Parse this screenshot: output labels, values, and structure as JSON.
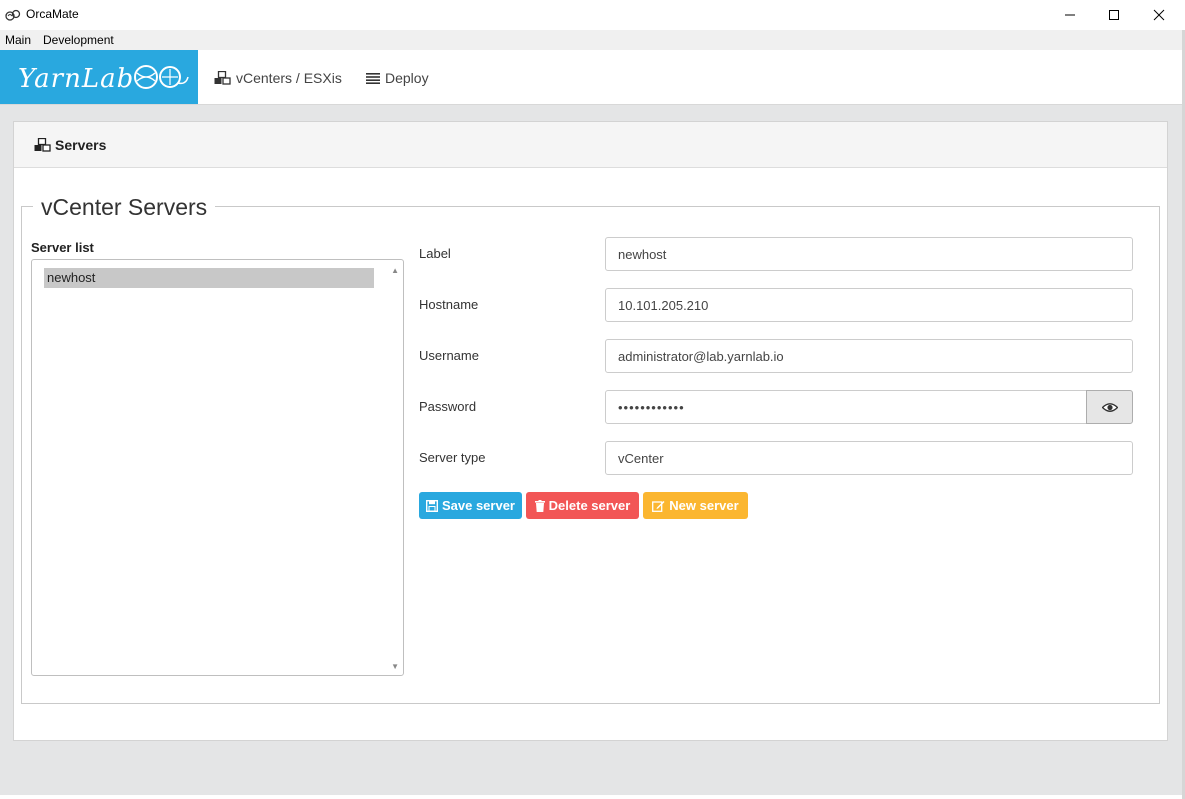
{
  "window": {
    "title": "OrcaMate"
  },
  "menu": {
    "items": [
      "Main",
      "Development"
    ]
  },
  "nav": {
    "logo_text": "YarnLab",
    "links": [
      {
        "label": "vCenters / ESXis",
        "icon": "cubes-icon"
      },
      {
        "label": "Deploy",
        "icon": "list-icon"
      }
    ]
  },
  "card": {
    "header_title": "Servers"
  },
  "fieldset": {
    "legend": "vCenter Servers"
  },
  "server_list": {
    "label": "Server list",
    "items": [
      "newhost"
    ],
    "selected": "newhost"
  },
  "form": {
    "label_label": "Label",
    "label_value": "newhost",
    "hostname_label": "Hostname",
    "hostname_value": "10.101.205.210",
    "username_label": "Username",
    "username_value": "administrator@lab.yarnlab.io",
    "password_label": "Password",
    "password_value": "••••••••••••",
    "server_type_label": "Server type",
    "server_type_value": "vCenter"
  },
  "buttons": {
    "save": "Save server",
    "delete": "Delete server",
    "new": "New server"
  },
  "colors": {
    "primary": "#29a8df",
    "danger": "#f25656",
    "warning": "#fbb630"
  }
}
